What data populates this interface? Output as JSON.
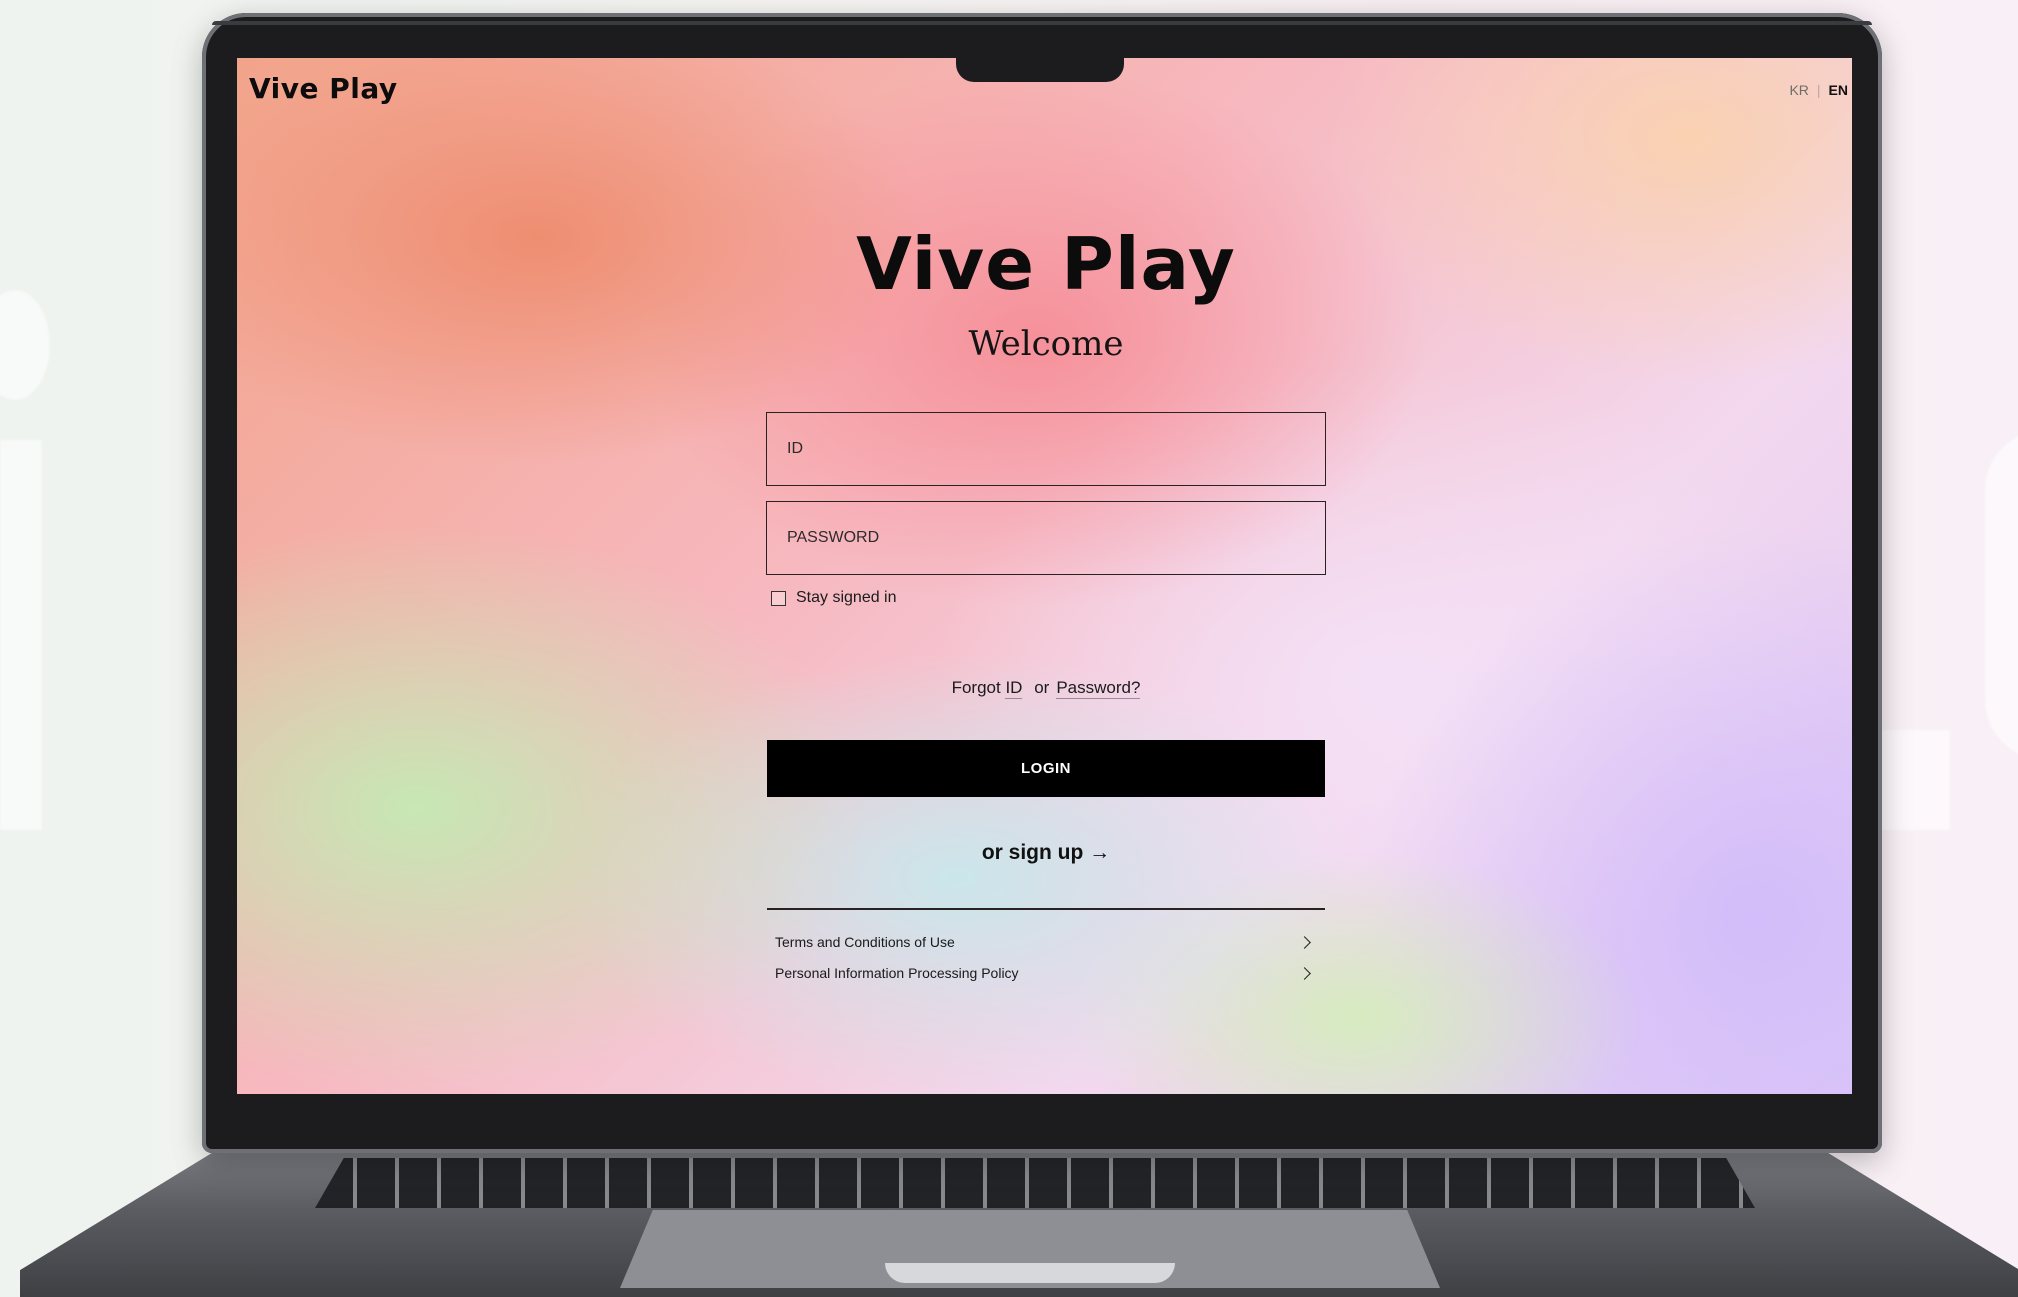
{
  "app": {
    "brand": "Vive Play"
  },
  "language": {
    "options": [
      "KR",
      "EN"
    ],
    "separator": "|",
    "selected": "EN"
  },
  "login": {
    "title": "Vive Play",
    "welcome": "Welcome",
    "id_placeholder": "ID",
    "password_placeholder": "PASSWORD",
    "stay_signed_in_label": "Stay signed in",
    "stay_signed_in_checked": false,
    "forgot": {
      "prefix": "Forgot",
      "id_link": "ID",
      "or": "or",
      "password_link": "Password?"
    },
    "login_button": "LOGIN",
    "signup_link": "or sign up →"
  },
  "policies": [
    {
      "label": "Terms and Conditions of Use"
    },
    {
      "label": "Personal Information Processing Policy"
    }
  ],
  "colors": {
    "button_bg": "#000000",
    "text": "#111111",
    "accent_gradient": [
      "#f2a48a",
      "#f7b8bf",
      "#c4eab4",
      "#dcc8f8"
    ]
  }
}
